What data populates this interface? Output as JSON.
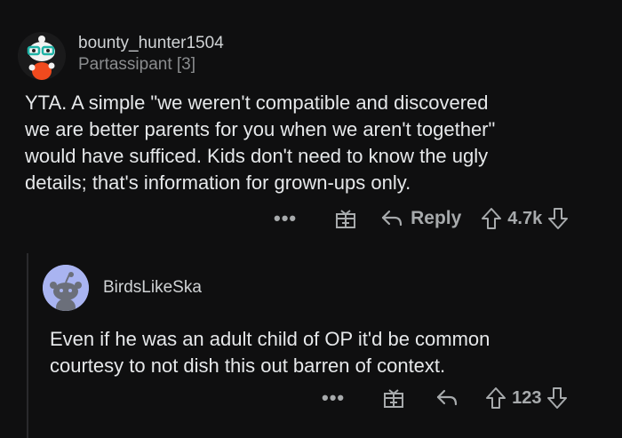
{
  "comments": [
    {
      "username": "bounty_hunter1504",
      "flair": "Partassipant [3]",
      "body": [
        "YTA. A simple \"we weren't compatible and discovered",
        "we are better parents for you when we aren't together\"",
        "would have sufficed. Kids don't need to know the ugly",
        "details; that's information for grown-ups only."
      ],
      "actions": {
        "more": "•••",
        "reply": "Reply",
        "score": "4.7k"
      }
    },
    {
      "username": "BirdsLikeSka",
      "body": [
        "Even if he was an adult child of OP it'd be common",
        "courtesy to not dish this out barren of context."
      ],
      "actions": {
        "more": "•••",
        "score": "123"
      }
    }
  ],
  "icons": {
    "more": "more-options-icon",
    "award": "gift-award-icon",
    "reply": "reply-arrow-icon",
    "upvote": "upvote-arrow-icon",
    "downvote": "downvote-arrow-icon"
  },
  "colors": {
    "background": "#0f0f10",
    "text": "#e6e8ea",
    "muted": "#8a8c8e",
    "icon": "#a7aaac",
    "avatar2": "#a9b4f1"
  }
}
